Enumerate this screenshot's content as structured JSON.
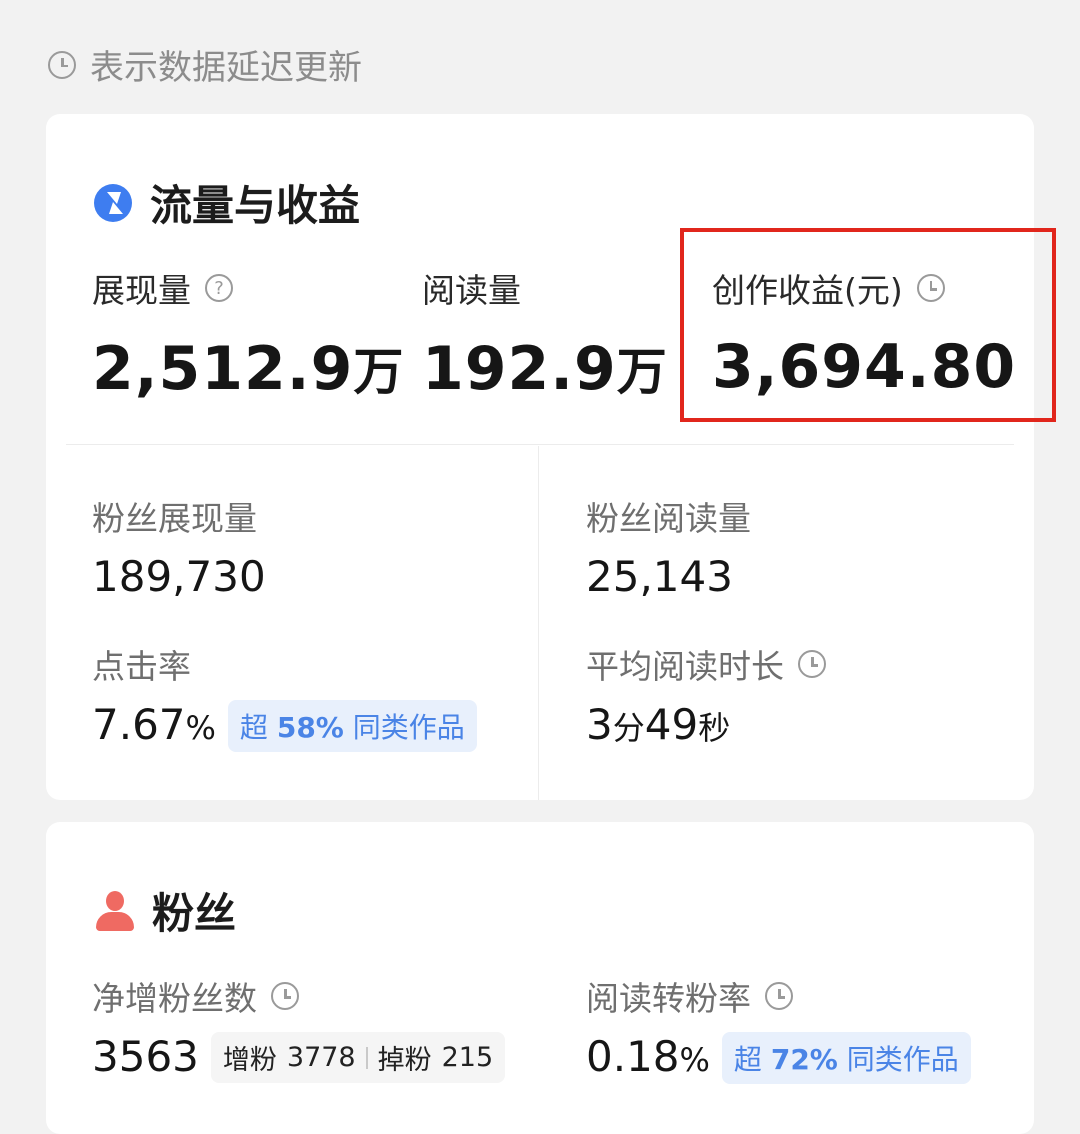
{
  "notice": "表示数据延迟更新",
  "traffic": {
    "title": "流量与收益",
    "impressions": {
      "label": "展现量",
      "value": "2,512.9",
      "unit": "万"
    },
    "reads": {
      "label": "阅读量",
      "value": "192.9",
      "unit": "万"
    },
    "earnings": {
      "label": "创作收益(元)",
      "value": "3,694.80"
    },
    "fan_impressions": {
      "label": "粉丝展现量",
      "value": "189,730"
    },
    "fan_reads": {
      "label": "粉丝阅读量",
      "value": "25,143"
    },
    "ctr": {
      "label": "点击率",
      "value": "7.67",
      "unit": "%",
      "badge_prefix": "超",
      "badge_pct": "58%",
      "badge_suffix": "同类作品"
    },
    "avg_read_time": {
      "label": "平均阅读时长",
      "minutes": "3",
      "min_unit": "分",
      "seconds": "49",
      "sec_unit": "秒"
    }
  },
  "fans": {
    "title": "粉丝",
    "net_gain": {
      "label": "净增粉丝数",
      "value": "3563",
      "gain_label": "增粉",
      "gain_value": "3778",
      "loss_label": "掉粉",
      "loss_value": "215"
    },
    "conversion": {
      "label": "阅读转粉率",
      "value": "0.18",
      "unit": "%",
      "badge_prefix": "超",
      "badge_pct": "72%",
      "badge_suffix": "同类作品"
    }
  },
  "colors": {
    "accent_blue": "#3e7df0",
    "highlight_red": "#e1261c",
    "fan_icon": "#ef6a62",
    "badge_text": "#4a84e6"
  },
  "icons": [
    "clock-icon",
    "bolt-icon",
    "help-icon",
    "person-icon"
  ]
}
